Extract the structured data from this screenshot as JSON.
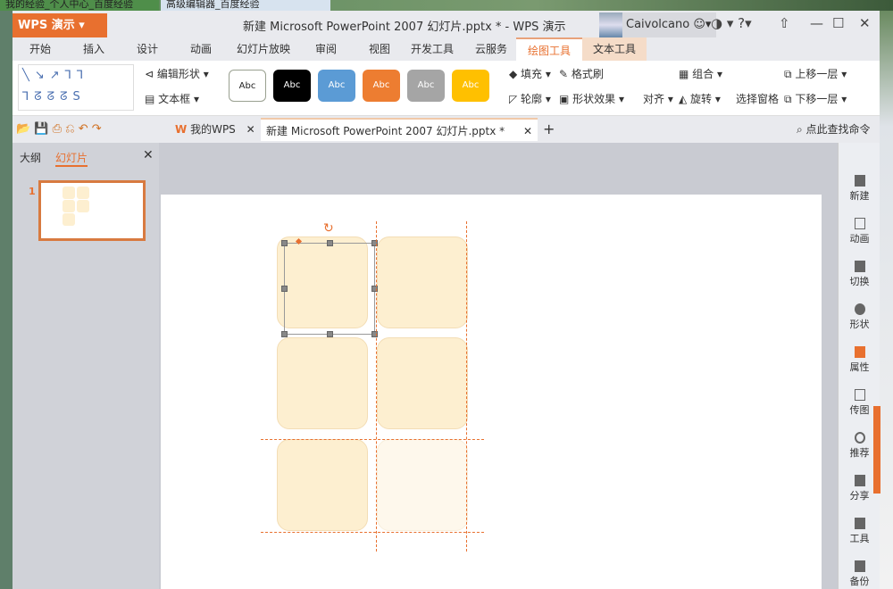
{
  "browser_tabs": [
    "我的经验_个人中心_百度经验",
    "高级编辑器_百度经验"
  ],
  "app": {
    "name": "WPS 演示",
    "title": "新建 Microsoft PowerPoint 2007 幻灯片.pptx * - WPS 演示",
    "user": "Caivolcano"
  },
  "ribbon_tabs": [
    "开始",
    "插入",
    "设计",
    "动画",
    "幻灯片放映",
    "审阅",
    "视图",
    "开发工具",
    "云服务",
    "绘图工具",
    "文本工具"
  ],
  "ribbon": {
    "edit_shape": "编辑形状",
    "textbox": "文本框",
    "style_label": "Abc",
    "fill": "填充",
    "format_painter": "格式刷",
    "outline": "轮廓",
    "shape_effects": "形状效果",
    "align": "对齐",
    "group": "组合",
    "rotate": "旋转",
    "selection_pane": "选择窗格",
    "bring_forward": "上移一层",
    "send_backward": "下移一层"
  },
  "doc_tabs": {
    "my_wps": "我的WPS",
    "doc": "新建 Microsoft PowerPoint 2007 幻灯片.pptx *",
    "search": "点此查找命令"
  },
  "left_panel": {
    "outline_tab": "大纲",
    "slides_tab": "幻灯片",
    "slide_number": "1"
  },
  "right_sidebar": [
    "新建",
    "动画",
    "切换",
    "形状",
    "属性",
    "传图",
    "推荐",
    "分享",
    "工具",
    "备份"
  ],
  "colors": {
    "accent": "#e8702f",
    "shape_fill": "#fdefd0"
  }
}
